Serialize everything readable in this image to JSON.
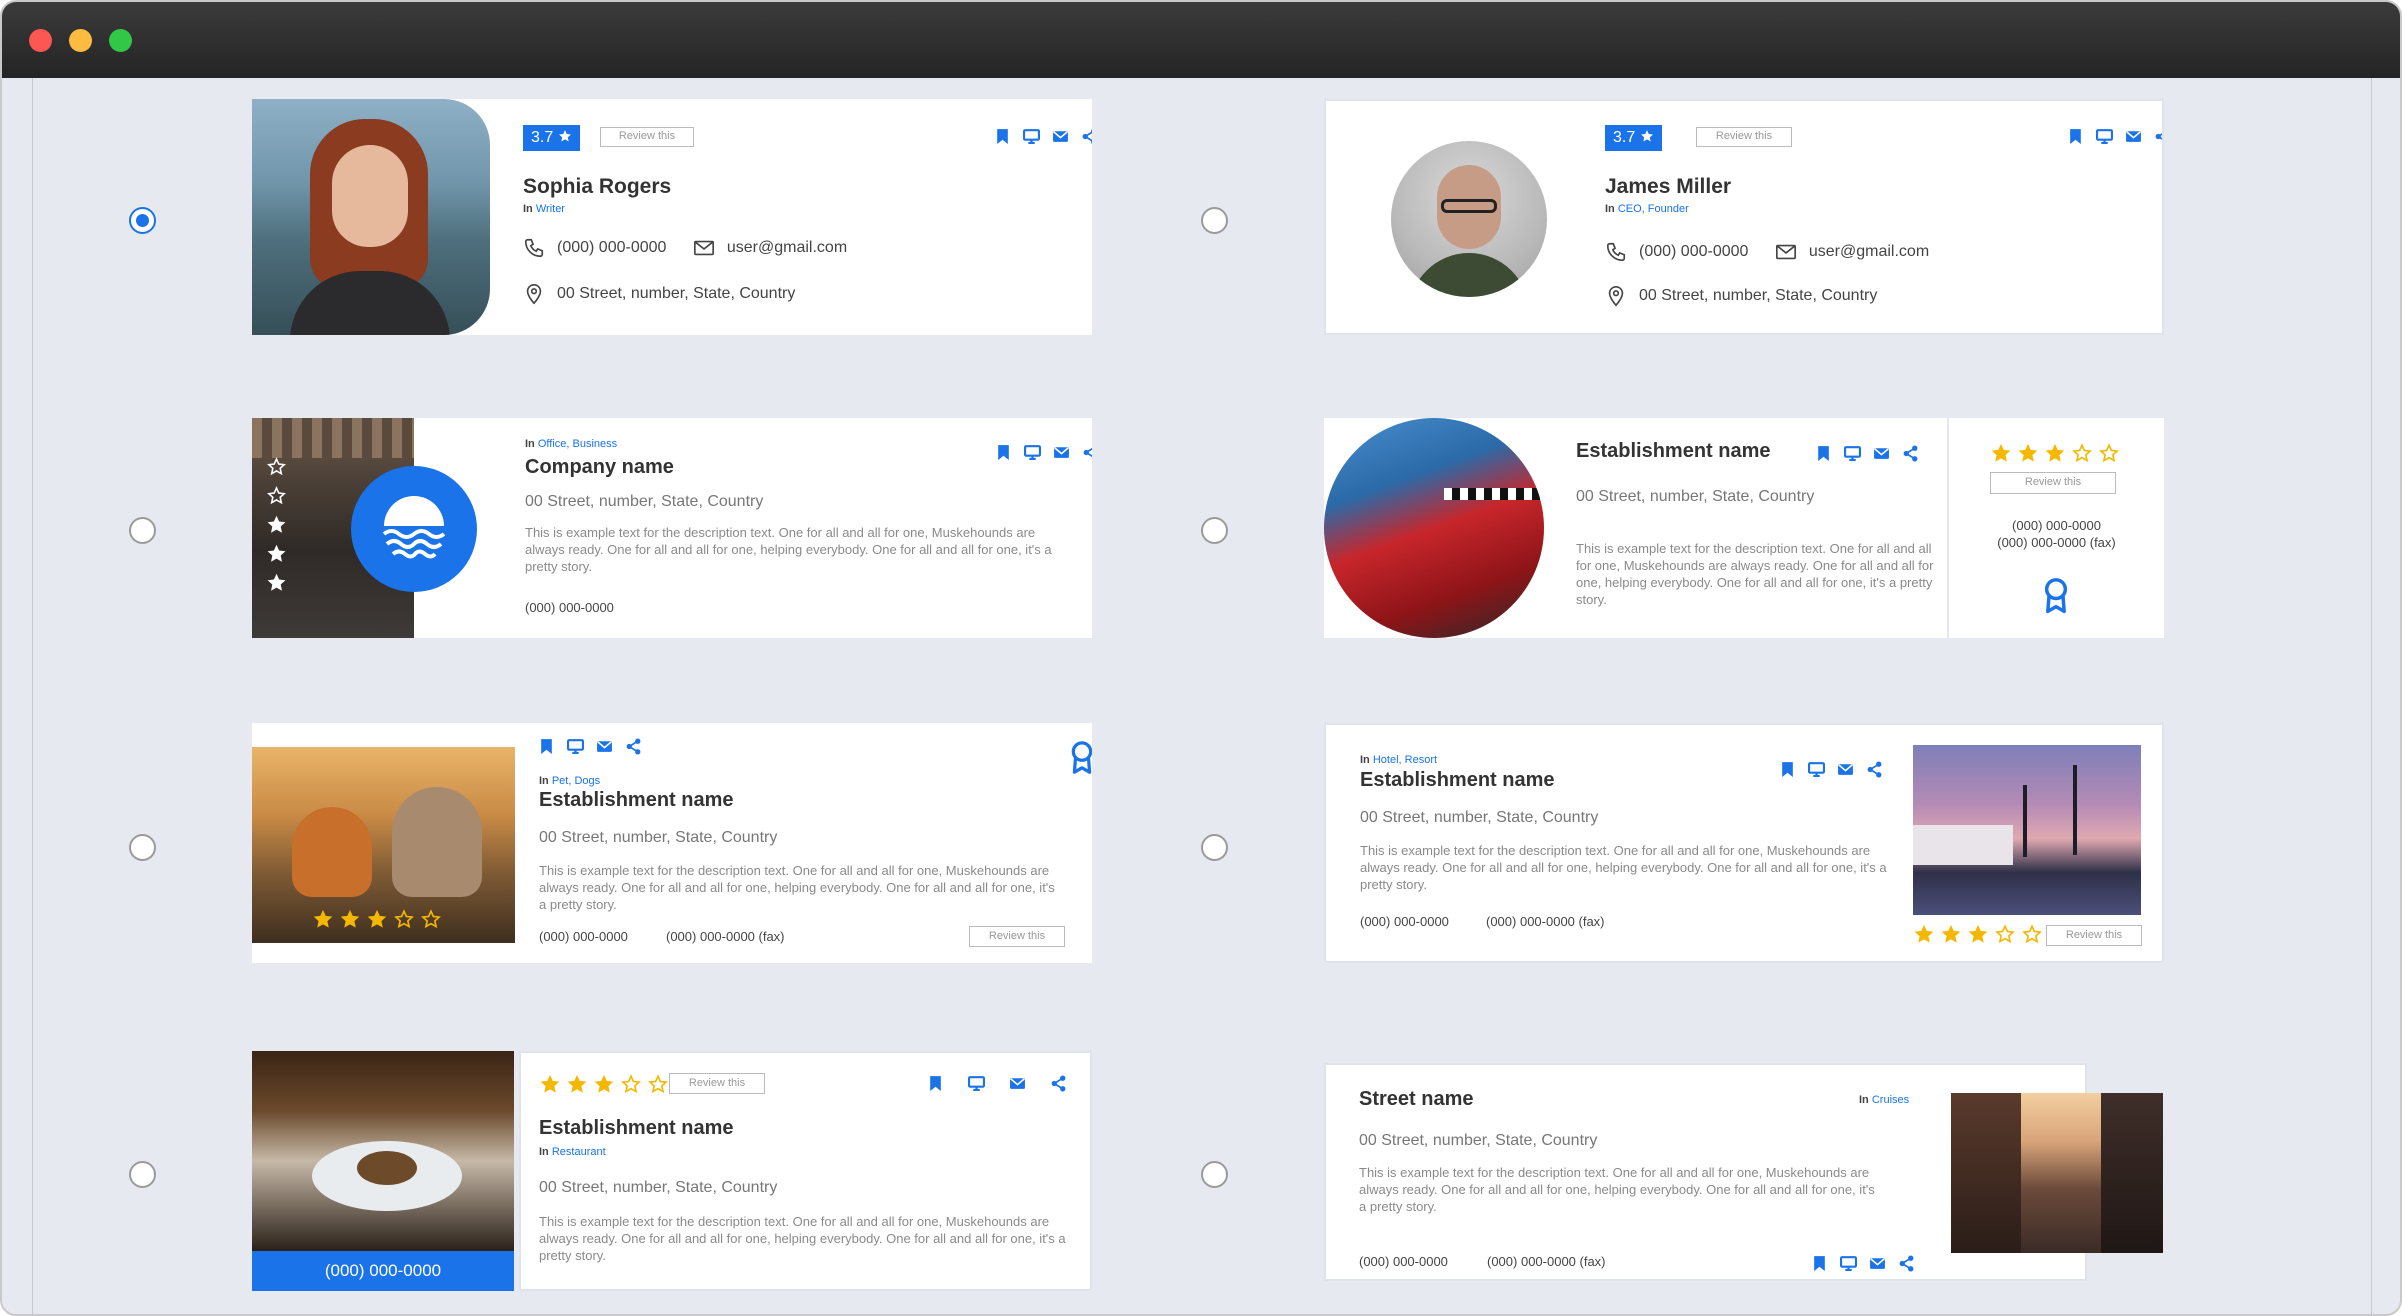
{
  "window": {
    "close_color": "#fc5753",
    "minimize_color": "#fdbc40",
    "maximize_color": "#33c748"
  },
  "accent": "#1a73e8",
  "star_color": "#f5b800",
  "selected_option": 1,
  "cards": {
    "c1": {
      "rating": "3.7",
      "review_label": "Review this",
      "name": "Sophia Rogers",
      "in": "In",
      "category": "Writer",
      "phone": "(000) 000-0000",
      "email": "user@gmail.com",
      "address": "00 Street, number, State, Country"
    },
    "c2": {
      "rating": "3.7",
      "review_label": "Review this",
      "name": "James Miller",
      "in": "In",
      "category": "CEO, Founder",
      "phone": "(000) 000-0000",
      "email": "user@gmail.com",
      "address": "00 Street, number, State, Country"
    },
    "c3": {
      "in": "In",
      "category": "Office, Business",
      "name": "Company name",
      "address": "00 Street, number, State, Country",
      "description": "This is example text for the description text. One for all and all for one, Muskehounds are always ready. One for all and all for one, helping everybody. One for all and all for one, it's a pretty story.",
      "phone": "(000) 000-0000",
      "stars_filled": 3,
      "stars_total": 5
    },
    "c4": {
      "name": "Establishment name",
      "address": "00 Street, number, State, Country",
      "description": "This is example text for the description text. One for all and all for one, Muskehounds are always ready. One for all and all for one, helping everybody. One for all and all for one, it's a pretty story.",
      "review_label": "Review this",
      "phone": "(000) 000-0000",
      "fax": "(000) 000-0000 (fax)",
      "stars_filled": 3,
      "stars_total": 5
    },
    "c5": {
      "in": "In",
      "category": "Pet, Dogs",
      "name": "Establishment name",
      "address": "00 Street, number, State, Country",
      "description": "This is example text for the description text. One for all and all for one, Muskehounds are always ready. One for all and all for one, helping everybody. One for all and all for one, it's a pretty story.",
      "phone": "(000) 000-0000",
      "fax": "(000) 000-0000 (fax)",
      "review_label": "Review this",
      "stars_filled": 3,
      "stars_total": 5
    },
    "c6": {
      "in": "In",
      "category": "Hotel, Resort",
      "name": "Establishment name",
      "address": "00 Street, number, State, Country",
      "description": "This is example text for the description text. One for all and all for one, Muskehounds are always ready. One for all and all for one, helping everybody. One for all and all for one, it's a pretty story.",
      "phone": "(000) 000-0000",
      "fax": "(000) 000-0000 (fax)",
      "review_label": "Review this",
      "stars_filled": 3,
      "stars_total": 5
    },
    "c7": {
      "review_label": "Review this",
      "name": "Establishment name",
      "in": "In",
      "category": "Restaurant",
      "address": "00 Street, number, State, Country",
      "description": "This is example text for the description text. One for all and all for one, Muskehounds are always ready. One for all and all for one, helping everybody. One for all and all for one, it's a pretty story.",
      "phone": "(000) 000-0000",
      "stars_filled": 3,
      "stars_total": 5
    },
    "c8": {
      "name": "Street name",
      "in": "In",
      "category": "Cruises",
      "address": "00 Street, number, State, Country",
      "description": "This is example text for the description text. One for all and all for one, Muskehounds are always ready. One for all and all for one, helping everybody. One for all and all for one, it's a pretty story.",
      "phone": "(000) 000-0000",
      "fax": "(000) 000-0000 (fax)"
    }
  }
}
